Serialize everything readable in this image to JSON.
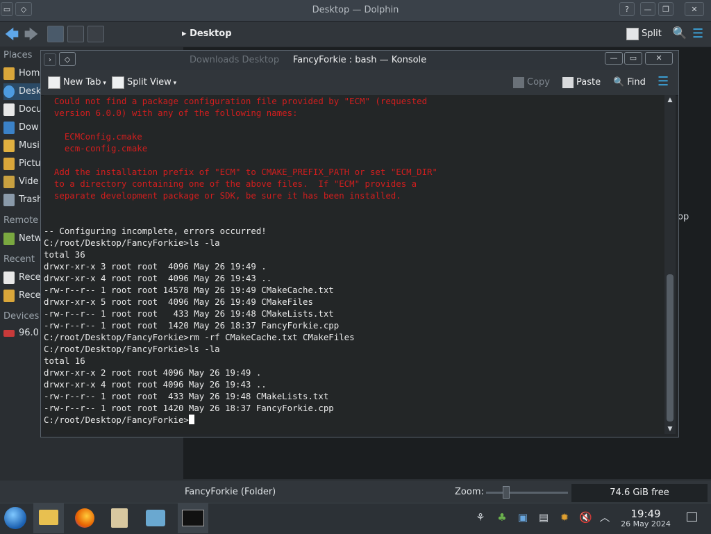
{
  "dolphin": {
    "title": "Desktop — Dolphin",
    "breadcrumb": "Desktop",
    "split_label": "Split",
    "places_header": "Places",
    "places": [
      "Hom",
      "Desk",
      "Docu",
      "Dow",
      "Musi",
      "Pictu",
      "Vide",
      "Trash"
    ],
    "remote_header": "Remote",
    "remote": [
      "Netw"
    ],
    "recent_header": "Recent",
    "recent": [
      "Rece",
      "Rece"
    ],
    "devices_header": "Devices",
    "devices": [
      "96.0"
    ],
    "behind_text": "op",
    "status_text": "FancyForkie (Folder)",
    "zoom_label": "Zoom:",
    "zoom_fraction": 0.22,
    "free_space": "74.6 GiB free"
  },
  "konsole": {
    "title": "FancyForkie : bash — Konsole",
    "ghost_tabs": "Downloads        Desktop",
    "toolbar": {
      "new_tab": "New Tab",
      "split_view": "Split View",
      "copy": "Copy",
      "paste": "Paste",
      "find": "Find"
    },
    "error_text": "  Could not find a package configuration file provided by \"ECM\" (requested\n  version 6.0.0) with any of the following names:\n\n    ECMConfig.cmake\n    ecm-config.cmake\n\n  Add the installation prefix of \"ECM\" to CMAKE_PREFIX_PATH or set \"ECM_DIR\"\n  to a directory containing one of the above files.  If \"ECM\" provides a\n  separate development package or SDK, be sure it has been installed.\n\n",
    "output_text": "\n-- Configuring incomplete, errors occurred!\nC:/root/Desktop/FancyForkie>ls -la\ntotal 36\ndrwxr-xr-x 3 root root  4096 May 26 19:49 .\ndrwxr-xr-x 4 root root  4096 May 26 19:43 ..\n-rw-r--r-- 1 root root 14578 May 26 19:49 CMakeCache.txt\ndrwxr-xr-x 5 root root  4096 May 26 19:49 CMakeFiles\n-rw-r--r-- 1 root root   433 May 26 19:48 CMakeLists.txt\n-rw-r--r-- 1 root root  1420 May 26 18:37 FancyForkie.cpp\nC:/root/Desktop/FancyForkie>rm -rf CMakeCache.txt CMakeFiles\nC:/root/Desktop/FancyForkie>ls -la\ntotal 16\ndrwxr-xr-x 2 root root 4096 May 26 19:49 .\ndrwxr-xr-x 4 root root 4096 May 26 19:43 ..\n-rw-r--r-- 1 root root  433 May 26 19:48 CMakeLists.txt\n-rw-r--r-- 1 root root 1420 May 26 18:37 FancyForkie.cpp\n",
    "prompt": "C:/root/Desktop/FancyForkie>"
  },
  "taskbar": {
    "time": "19:49",
    "date": "26 May 2024"
  },
  "colors": {
    "accent": "#3daee9",
    "terminal_bg": "#232627",
    "error_red": "#d21e1e"
  }
}
